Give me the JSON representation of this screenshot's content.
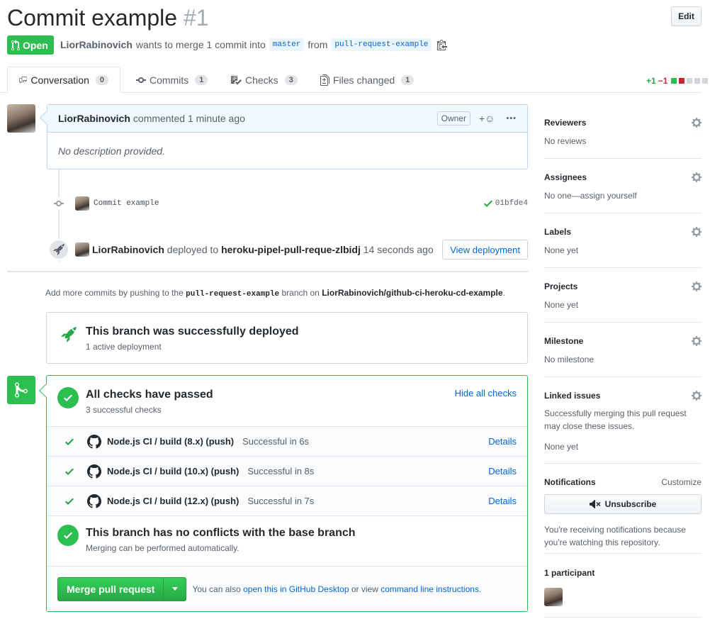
{
  "pr": {
    "title": "Commit example",
    "number": "#1",
    "state": "Open",
    "author": "LiorRabinovich",
    "merge_text": "wants to merge 1 commit into",
    "base_branch": "master",
    "from_text": "from",
    "head_branch": "pull-request-example",
    "edit_label": "Edit"
  },
  "tabs": [
    {
      "label": "Conversation",
      "count": "0",
      "icon": "comment-discussion-icon"
    },
    {
      "label": "Commits",
      "count": "1",
      "icon": "git-commit-icon"
    },
    {
      "label": "Checks",
      "count": "3",
      "icon": "checklist-icon"
    },
    {
      "label": "Files changed",
      "count": "1",
      "icon": "file-diff-icon"
    }
  ],
  "diffstat": {
    "additions": "+1",
    "deletions": "−1",
    "colors": [
      "#2cbe4e",
      "#cb2431",
      "#d1d5da"
    ]
  },
  "comment": {
    "author": "LiorRabinovich",
    "action": "commented",
    "time": "1 minute ago",
    "role": "Owner",
    "reaction": "+☺",
    "more": "•••",
    "body": "No description provided."
  },
  "commit": {
    "message": "Commit example",
    "sha": "01bfde4"
  },
  "deployment": {
    "author": "LiorRabinovich",
    "action": "deployed to",
    "env": "heroku-pipel-pull-reque-zlbidj",
    "time": "14 seconds ago",
    "button": "View deployment"
  },
  "push_hint": {
    "prefix": "Add more commits by pushing to the",
    "branch": "pull-request-example",
    "middle": "branch on",
    "repo": "LiorRabinovich/github-ci-heroku-cd-example",
    "suffix": "."
  },
  "deploy_status": {
    "title": "This branch was successfully deployed",
    "sub": "1 active deployment"
  },
  "checks": {
    "title": "All checks have passed",
    "sub": "3 successful checks",
    "toggle": "Hide all checks",
    "items": [
      {
        "name": "Node.js CI / build (8.x) (push)",
        "status": "Successful in 6s",
        "link": "Details"
      },
      {
        "name": "Node.js CI / build (10.x) (push)",
        "status": "Successful in 8s",
        "link": "Details"
      },
      {
        "name": "Node.js CI / build (12.x) (push)",
        "status": "Successful in 7s",
        "link": "Details"
      }
    ]
  },
  "conflicts": {
    "title": "This branch has no conflicts with the base branch",
    "sub": "Merging can be performed automatically."
  },
  "merge": {
    "button": "Merge pull request",
    "alt_prefix": "You can also",
    "alt_link1": "open this in GitHub Desktop",
    "alt_middle": "or view",
    "alt_link2": "command line instructions",
    "alt_suffix": "."
  },
  "sidebar": {
    "reviewers": {
      "title": "Reviewers",
      "value": "No reviews"
    },
    "assignees": {
      "title": "Assignees",
      "value": "No one—assign yourself"
    },
    "labels": {
      "title": "Labels",
      "value": "None yet"
    },
    "projects": {
      "title": "Projects",
      "value": "None yet"
    },
    "milestone": {
      "title": "Milestone",
      "value": "No milestone"
    },
    "linked": {
      "title": "Linked issues",
      "note1": "Successfully merging this pull request",
      "note2": "may close these issues.",
      "value": "None yet"
    },
    "notifications": {
      "title": "Notifications",
      "customize": "Customize",
      "button": "Unsubscribe",
      "note1": "You're receiving notifications because",
      "note2": "you're watching this repository."
    },
    "participants": {
      "title": "1 participant"
    }
  }
}
